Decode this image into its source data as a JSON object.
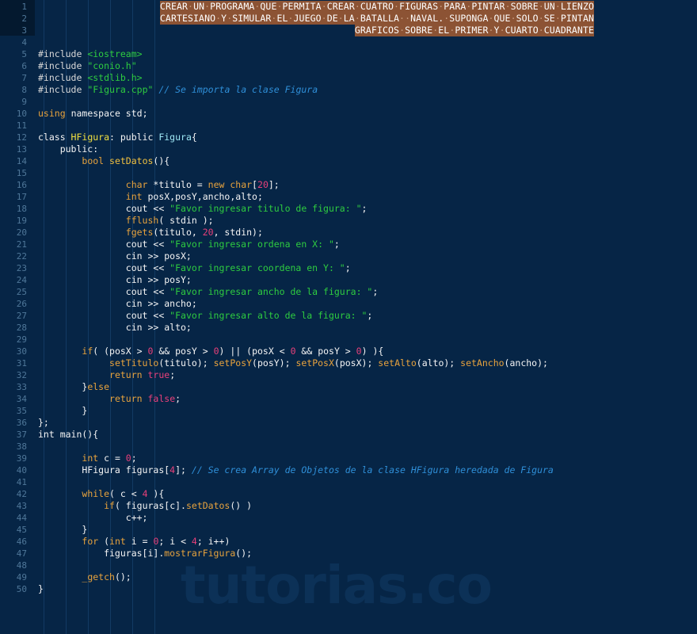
{
  "editor": {
    "language": "C++",
    "watermark": "tutorias.co",
    "colors": {
      "background": "#062546",
      "gutter_text": "#4f7799",
      "gutter_selection": "#04192f",
      "header_highlight_bg": "#8c5334",
      "keyword": "#e8a33d",
      "string": "#2ecc40",
      "number": "#e8407a",
      "comment": "#2f8fd8",
      "class_name": "#f0e040",
      "type_name": "#9fe8f5",
      "plain_text": "#f5f5f5",
      "indent_guide": "#123a63",
      "watermark": "#0c3157"
    },
    "total_lines": 50,
    "first_line_number": 1
  },
  "header_prompt": {
    "lines": [
      "CREAR UN PROGRAMA QUE PERMITA CREAR CUATRO FIGURAS PARA PINTAR SOBRE UN LIENZO",
      "CARTESIANO Y SIMULAR EL JUEGO DE LA BATALLA  NAVAL. SUPONGA QUE SOLO SE PINTAN",
      "GRAFICOS SOBRE EL PRIMER Y CUARTO CUADRANTE"
    ],
    "space_dot_glyph": "·"
  },
  "line_numbers": [
    1,
    2,
    3,
    4,
    5,
    6,
    7,
    8,
    9,
    10,
    11,
    12,
    13,
    14,
    15,
    16,
    17,
    18,
    19,
    20,
    21,
    22,
    23,
    24,
    25,
    26,
    27,
    28,
    29,
    30,
    31,
    32,
    33,
    34,
    35,
    36,
    37,
    38,
    39,
    40,
    41,
    42,
    43,
    44,
    45,
    46,
    47,
    48,
    49,
    50
  ],
  "code_lines": [
    "",
    "",
    "",
    "",
    "#include <iostream>",
    "#include \"conio.h\"",
    "#include <stdlib.h>",
    "#include \"Figura.cpp\" // Se importa la clase Figura",
    "",
    "using namespace std;",
    "",
    "class HFigura: public Figura{",
    "    public:",
    "        bool setDatos(){",
    "",
    "                char *titulo = new char[20];",
    "                int posX,posY,ancho,alto;",
    "                cout << \"Favor ingresar titulo de figura: \";",
    "                fflush( stdin );",
    "                fgets(titulo, 20, stdin);",
    "                cout << \"Favor ingresar ordena en X: \";",
    "                cin >> posX;",
    "                cout << \"Favor ingresar coordena en Y: \";",
    "                cin >> posY;",
    "                cout << \"Favor ingresar ancho de la figura: \";",
    "                cin >> ancho;",
    "                cout << \"Favor ingresar alto de la figura: \";",
    "                cin >> alto;",
    "",
    "        if( (posX > 0 && posY > 0) || (posX < 0 && posY > 0) ){",
    "             setTitulo(titulo); setPosY(posY); setPosX(posX); setAlto(alto); setAncho(ancho);",
    "             return true;",
    "        }else",
    "             return false;",
    "        }",
    "};",
    "int main(){",
    "",
    "        int c = 0;",
    "        HFigura figuras[4]; // Se crea Array de Objetos de la clase HFigura heredada de Figura",
    "",
    "        while( c < 4 ){",
    "            if( figuras[c].setDatos() )",
    "                c++;",
    "        }",
    "        for (int i = 0; i < 4; i++)",
    "            figuras[i].mostrarFigura();",
    "",
    "        _getch();",
    "}"
  ]
}
